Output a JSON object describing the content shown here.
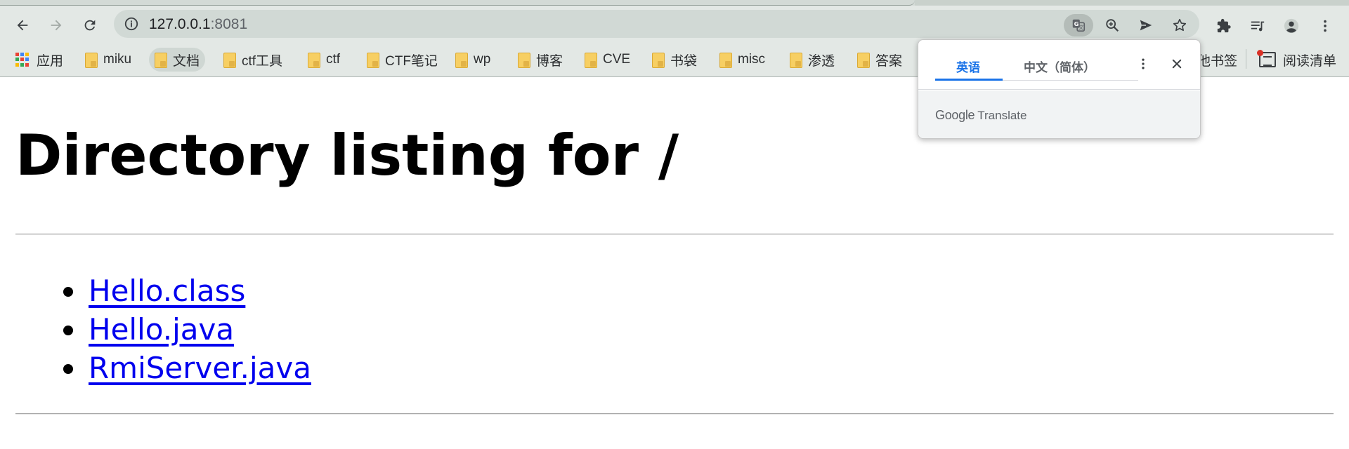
{
  "browser": {
    "address": {
      "host": "127.0.0.1",
      "port": ":8081"
    },
    "icons": {
      "back": "back-arrow-icon",
      "forward": "forward-arrow-icon",
      "reload": "reload-icon",
      "site_info": "info-icon",
      "translate": "translate-icon",
      "zoom": "zoom-in-icon",
      "send": "send-icon",
      "bookmark_star": "star-icon",
      "extensions": "puzzle-icon",
      "media": "media-queue-icon",
      "profile": "profile-icon",
      "menu": "kebab-menu-icon"
    }
  },
  "bookmarks": [
    {
      "label": "应用",
      "kind": "apps"
    },
    {
      "label": "miku",
      "kind": "folder"
    },
    {
      "label": "文档",
      "kind": "folder"
    },
    {
      "label": "ctf工具",
      "kind": "folder"
    },
    {
      "label": "ctf",
      "kind": "folder"
    },
    {
      "label": "CTF笔记",
      "kind": "folder"
    },
    {
      "label": "wp",
      "kind": "folder"
    },
    {
      "label": "博客",
      "kind": "folder"
    },
    {
      "label": "CVE",
      "kind": "folder"
    },
    {
      "label": "书袋",
      "kind": "folder"
    },
    {
      "label": "misc",
      "kind": "folder"
    },
    {
      "label": "渗透",
      "kind": "folder"
    },
    {
      "label": "答案",
      "kind": "folder"
    }
  ],
  "bookmarks_right": {
    "other_bookmarks": "他书签",
    "reading_list": "阅读清单"
  },
  "page": {
    "heading": "Directory listing for /",
    "files": [
      "Hello.class",
      "Hello.java",
      "RmiServer.java"
    ]
  },
  "translate_bubble": {
    "source_language": "英语",
    "target_language": "中文（简体）",
    "brand_google": "Google",
    "brand_translate": "Translate"
  },
  "colors": {
    "chrome_bg": "#e3e8e5",
    "link": "#0000ee",
    "accent": "#1a73e8"
  }
}
